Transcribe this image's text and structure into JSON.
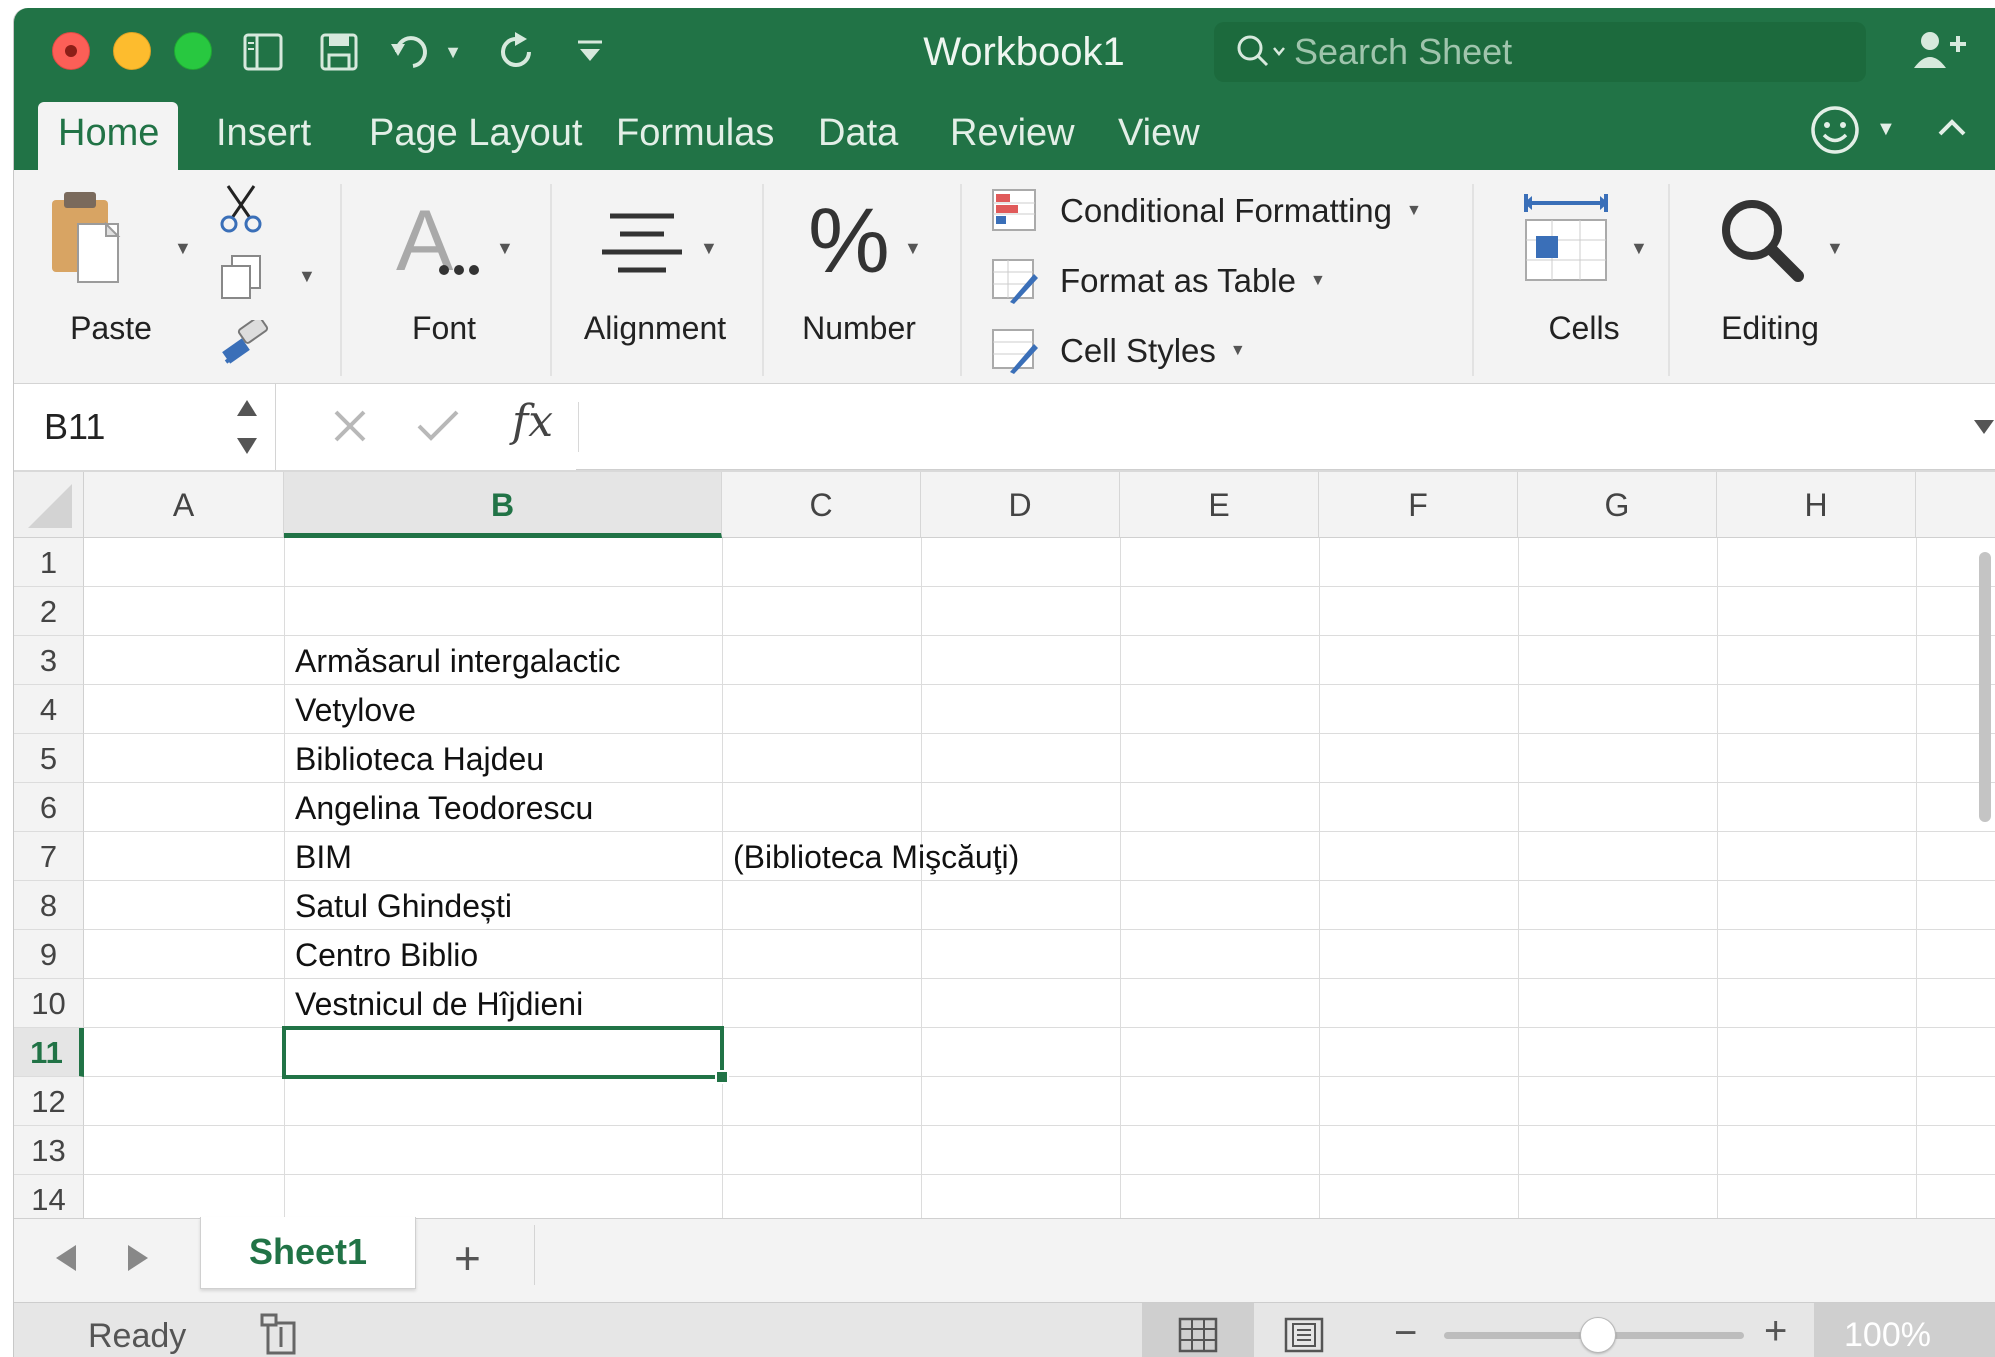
{
  "window": {
    "title": "Workbook1"
  },
  "search": {
    "placeholder": "Search Sheet"
  },
  "ribbon_tabs": [
    "Home",
    "Insert",
    "Page Layout",
    "Formulas",
    "Data",
    "Review",
    "View"
  ],
  "active_tab": "Home",
  "ribbon": {
    "paste_label": "Paste",
    "font_label": "Font",
    "alignment_label": "Alignment",
    "number_label": "Number",
    "conditional_formatting": "Conditional Formatting",
    "format_as_table": "Format as Table",
    "cell_styles": "Cell Styles",
    "cells_label": "Cells",
    "editing_label": "Editing"
  },
  "formula_bar": {
    "name_box": "B11",
    "fx": "fx",
    "formula": ""
  },
  "columns": [
    "A",
    "B",
    "C",
    "D",
    "E",
    "F",
    "G",
    "H"
  ],
  "selected_column": "B",
  "rows": [
    "1",
    "2",
    "3",
    "4",
    "5",
    "6",
    "7",
    "8",
    "9",
    "10",
    "11",
    "12",
    "13",
    "14"
  ],
  "selected_row": "11",
  "cells": {
    "B3": "Armăsarul intergalactic",
    "B4": "Vetylove",
    "B5": "Biblioteca Hajdeu",
    "B6": "Angelina Teodorescu",
    "B7": "BIM",
    "C7": "(Biblioteca Mişcăuţi)",
    "B8": "Satul Ghindești",
    "B9": "Centro Biblio",
    "B10": "Vestnicul de Hîjdieni"
  },
  "sheets": [
    "Sheet1"
  ],
  "active_sheet": "Sheet1",
  "add_sheet_label": "+",
  "status": {
    "text": "Ready",
    "zoom": "100%",
    "zoom_minus": "−",
    "zoom_plus": "+"
  },
  "colors": {
    "accent": "#217346",
    "title_bar": "#217346"
  }
}
